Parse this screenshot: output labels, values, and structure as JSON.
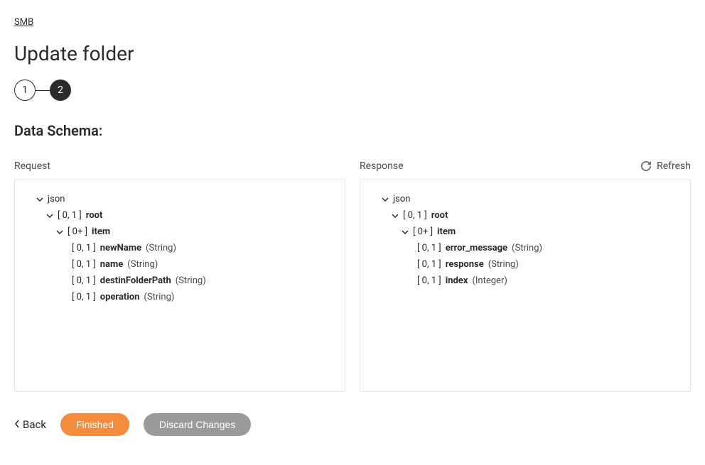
{
  "breadcrumb": "SMB",
  "title": "Update folder",
  "stepper": {
    "step1": "1",
    "step2": "2"
  },
  "sectionTitle": "Data Schema:",
  "labels": {
    "request": "Request",
    "response": "Response",
    "refresh": "Refresh"
  },
  "requestTree": {
    "json": "json",
    "rootCardinality": "[ 0, 1 ]",
    "rootName": "root",
    "itemCardinality": "[ 0+ ]",
    "itemName": "item",
    "fields": [
      {
        "card": "[ 0, 1 ]",
        "name": "newName",
        "type": "(String)"
      },
      {
        "card": "[ 0, 1 ]",
        "name": "name",
        "type": "(String)"
      },
      {
        "card": "[ 0, 1 ]",
        "name": "destinFolderPath",
        "type": "(String)"
      },
      {
        "card": "[ 0, 1 ]",
        "name": "operation",
        "type": "(String)"
      }
    ]
  },
  "responseTree": {
    "json": "json",
    "rootCardinality": "[ 0, 1 ]",
    "rootName": "root",
    "itemCardinality": "[ 0+ ]",
    "itemName": "item",
    "fields": [
      {
        "card": "[ 0, 1 ]",
        "name": "error_message",
        "type": "(String)"
      },
      {
        "card": "[ 0, 1 ]",
        "name": "response",
        "type": "(String)"
      },
      {
        "card": "[ 0, 1 ]",
        "name": "index",
        "type": "(Integer)"
      }
    ]
  },
  "footer": {
    "back": "Back",
    "finished": "Finished",
    "discard": "Discard Changes"
  }
}
